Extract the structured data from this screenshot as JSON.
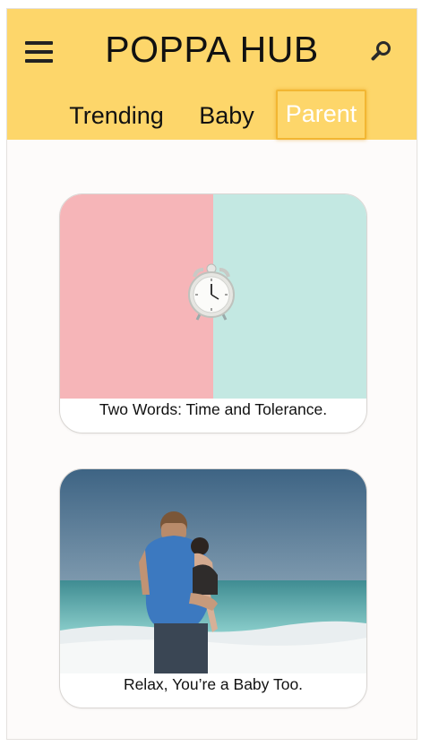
{
  "header": {
    "title": "POPPA HUB",
    "menu_icon": "hamburger-menu-icon",
    "search_icon": "search-icon",
    "background": "#fdd66a"
  },
  "tabs": [
    {
      "label": "Trending",
      "active": false
    },
    {
      "label": "Baby",
      "active": false
    },
    {
      "label": "Parent",
      "active": true
    }
  ],
  "cards": [
    {
      "caption": "Two Words: Time and Tolerance.",
      "image": "alarm clock on pink and mint background"
    },
    {
      "caption": "Relax, You’re a Baby Too.",
      "image": "father holding child at the beach"
    }
  ],
  "colors": {
    "active_tab_text": "#ffffff",
    "active_tab_border": "#f2b632"
  }
}
